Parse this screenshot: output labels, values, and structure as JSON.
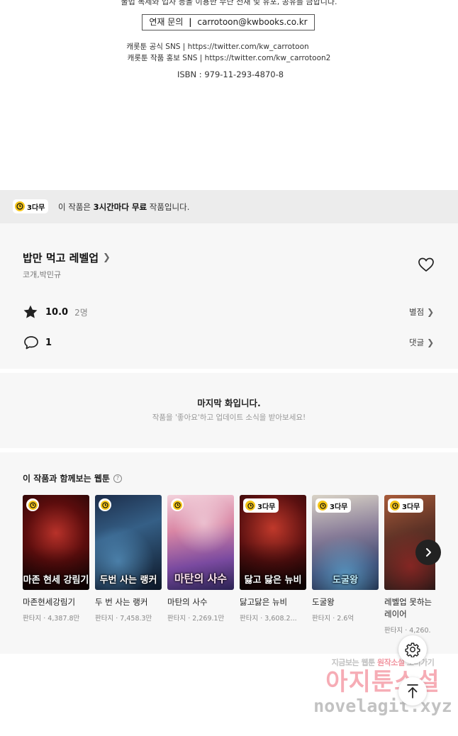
{
  "credits": {
    "cut_text": "불법 복제와 업자 등을 이용한 무단 전재 및 유포, 공유를 금합니다.",
    "contact_label": "연재 문의",
    "contact_email": "carrotoon@kwbooks.co.kr",
    "sns_official": "캐롯툰 공식 SNS | https://twitter.com/kw_carrotoon",
    "sns_promo": "캐롯툰 작품 홍보 SNS | https://twitter.com/kw_carrotoon2",
    "isbn": "ISBN : 979-11-293-4870-8"
  },
  "banner": {
    "badge": "3다무",
    "msg_pre": "이 작품은 ",
    "msg_bold": "3시간마다 무료",
    "msg_post": " 작품입니다."
  },
  "work": {
    "title": "밥만 먹고 레벨업",
    "authors": "코개,박민규",
    "rating": "10.0",
    "rating_count": "2명",
    "rate_label": "별점",
    "comment_count": "1",
    "comment_label": "댓글"
  },
  "last_episode": {
    "title": "마지막 화입니다.",
    "subtitle": "작품을 '좋아요'하고 업데이트 소식을 받아보세요!"
  },
  "recommendations": {
    "heading": "이 작품과 함께보는 웹툰",
    "items": [
      {
        "name": "마존현세강림기",
        "genre": "판타지",
        "views": "4,387.8만",
        "badge": "",
        "cover_text": "마존 현세 강림기"
      },
      {
        "name": "두 번 사는 랭커",
        "genre": "판타지",
        "views": "7,458.3만",
        "badge": "",
        "cover_text": "두번 사는 랭커"
      },
      {
        "name": "마탄의 사수",
        "genre": "판타지",
        "views": "2,269.1만",
        "badge": "",
        "cover_text": "마탄의 사수"
      },
      {
        "name": "닳고닳은 뉴비",
        "genre": "판타지",
        "views": "3,608.2...",
        "badge": "3다무",
        "cover_text": "닳고 닳은 뉴비"
      },
      {
        "name": "도굴왕",
        "genre": "판타지",
        "views": "2.6억",
        "badge": "3다무",
        "cover_text": "도굴왕"
      },
      {
        "name": "레벨업 못하는 레이어",
        "genre": "판타지",
        "views": "4,260.",
        "badge": "3다무",
        "cover_text": ""
      }
    ]
  },
  "watermark": {
    "line1_a": "지금보는 웹툰",
    "line1_b": "원작소설",
    "line1_c": "보러가기",
    "line2": "아지툰소설",
    "line3": "novelagit.xyz"
  },
  "icons": {
    "clock": "clock-icon",
    "heart": "heart-outline-icon",
    "star": "star-filled-icon",
    "comment": "speech-bubble-icon",
    "next": "chevron-right-icon",
    "settings": "gear-icon",
    "top": "arrow-up-icon"
  },
  "colors": {
    "badge_yellow": "#f5c518",
    "banner_bg": "#ececec",
    "section_bg": "#f7f7f7"
  }
}
